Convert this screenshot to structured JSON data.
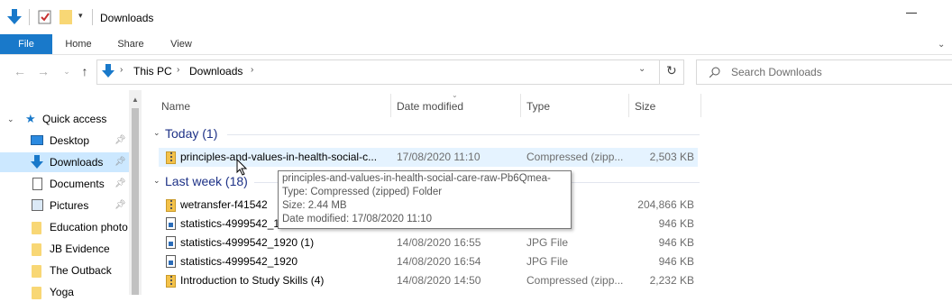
{
  "window": {
    "title": "Downloads"
  },
  "ribbon": {
    "tabs": [
      "File",
      "Home",
      "Share",
      "View"
    ]
  },
  "address": {
    "breadcrumb": [
      "This PC",
      "Downloads"
    ],
    "search_placeholder": "Search Downloads"
  },
  "nav": {
    "items": [
      {
        "label": "Quick access",
        "icon": "star-icon",
        "pinned": false
      },
      {
        "label": "Desktop",
        "icon": "desktop-icon",
        "pinned": true
      },
      {
        "label": "Downloads",
        "icon": "download-arrow-icon",
        "pinned": true,
        "selected": true
      },
      {
        "label": "Documents",
        "icon": "documents-icon",
        "pinned": true
      },
      {
        "label": "Pictures",
        "icon": "pictures-icon",
        "pinned": true
      },
      {
        "label": "Education photo",
        "icon": "folder-icon",
        "pinned": false
      },
      {
        "label": "JB Evidence",
        "icon": "folder-icon",
        "pinned": false
      },
      {
        "label": "The Outback",
        "icon": "folder-icon",
        "pinned": false
      },
      {
        "label": "Yoga",
        "icon": "folder-icon",
        "pinned": false
      }
    ]
  },
  "columns": {
    "name": "Name",
    "date": "Date modified",
    "type": "Type",
    "size": "Size"
  },
  "groups": [
    {
      "label": "Today (1)"
    },
    {
      "label": "Last week (18)"
    }
  ],
  "files": [
    {
      "name": "principles-and-values-in-health-social-c...",
      "date": "17/08/2020 11:10",
      "type": "Compressed (zipp...",
      "size": "2,503 KB",
      "icon": "zip-icon"
    },
    {
      "name": "wetransfer-f41542",
      "date": "",
      "type": "",
      "size": "204,866 KB",
      "icon": "zip-icon"
    },
    {
      "name": "statistics-4999542_19",
      "date": "",
      "type": "",
      "size": "946 KB",
      "icon": "jpg-icon"
    },
    {
      "name": "statistics-4999542_1920 (1)",
      "date": "14/08/2020 16:55",
      "type": "JPG File",
      "size": "946 KB",
      "icon": "jpg-icon"
    },
    {
      "name": "statistics-4999542_1920",
      "date": "14/08/2020 16:54",
      "type": "JPG File",
      "size": "946 KB",
      "icon": "jpg-icon"
    },
    {
      "name": "Introduction to Study Skills (4)",
      "date": "14/08/2020 14:50",
      "type": "Compressed (zipp...",
      "size": "2,232 KB",
      "icon": "zip-icon"
    }
  ],
  "tooltip": {
    "line1": "principles-and-values-in-health-social-care-raw-Pb6Qmea-",
    "line2": "Type: Compressed (zipped) Folder",
    "line3": "Size: 2.44 MB",
    "line4": "Date modified: 17/08/2020 11:10"
  },
  "colors": {
    "accent": "#1979ca",
    "group_text": "#1e3287",
    "selection": "#cce8ff"
  }
}
